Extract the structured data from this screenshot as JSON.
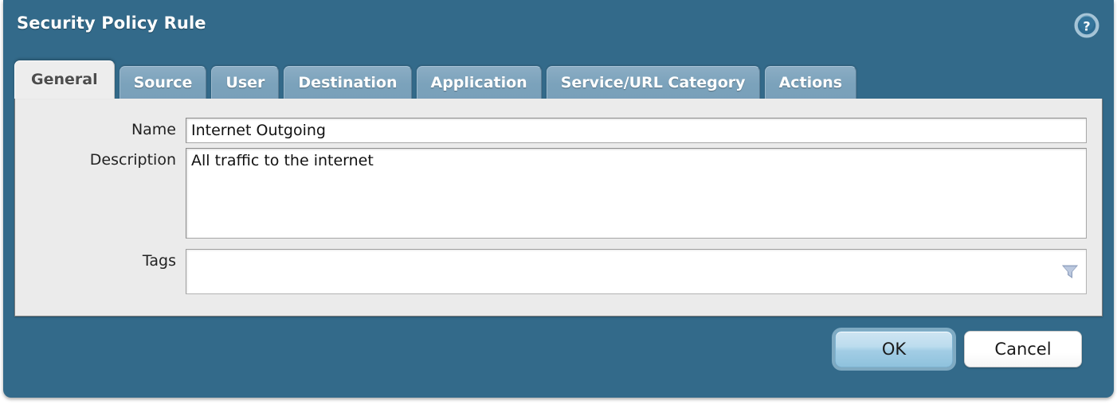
{
  "dialog": {
    "title": "Security Policy Rule",
    "help_icon": "help-circle-icon",
    "accent_color": "#336a8a",
    "panel_color": "#ebebeb"
  },
  "tabs": [
    {
      "label": "General",
      "active": true
    },
    {
      "label": "Source",
      "active": false
    },
    {
      "label": "User",
      "active": false
    },
    {
      "label": "Destination",
      "active": false
    },
    {
      "label": "Application",
      "active": false
    },
    {
      "label": "Service/URL Category",
      "active": false
    },
    {
      "label": "Actions",
      "active": false
    }
  ],
  "form": {
    "name": {
      "label": "Name",
      "value": "Internet Outgoing",
      "placeholder": ""
    },
    "description": {
      "label": "Description",
      "value": "All traffic to the internet",
      "placeholder": ""
    },
    "tags": {
      "label": "Tags",
      "value": "",
      "placeholder": "",
      "dropdown_icon": "filter-dropdown-icon"
    }
  },
  "footer": {
    "ok_label": "OK",
    "cancel_label": "Cancel"
  }
}
